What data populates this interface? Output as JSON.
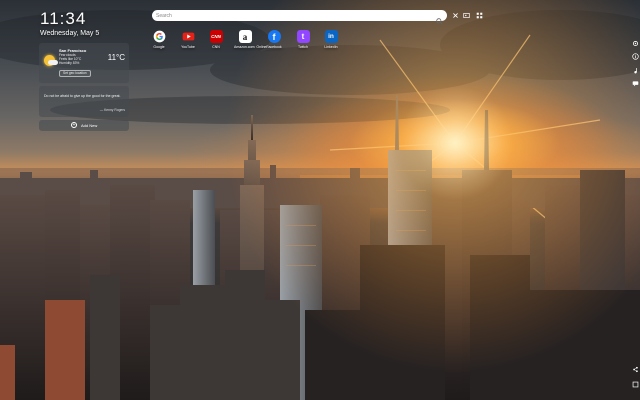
{
  "clock": {
    "time": "11:34",
    "date": "Wednesday, May 5"
  },
  "weather": {
    "city": "San Francisco",
    "condition_line1": "Few clouds",
    "condition_line2": "Feels like 10°C",
    "condition_line3": "Humidity 83%",
    "temperature": "11°C",
    "location_button": "Set geo location"
  },
  "quote": {
    "text": "Do not be afraid to give up the good for the great.",
    "author": "— Kenny Rogers"
  },
  "widgets": {
    "add_new": "Add New"
  },
  "search": {
    "placeholder": "Search"
  },
  "shortcuts": [
    {
      "name": "Google",
      "color": "#ffffff",
      "glyph": "G"
    },
    {
      "name": "YouTube",
      "color": "#e62117",
      "glyph": "▶"
    },
    {
      "name": "CNN",
      "color": "#cc0000",
      "glyph": "CNN"
    },
    {
      "name": "Amazon.com: Online...",
      "color": "#ffffff",
      "glyph": "a"
    },
    {
      "name": "Facebook",
      "color": "#1877f2",
      "glyph": "f"
    },
    {
      "name": "Twitch",
      "color": "#9146ff",
      "glyph": "t"
    },
    {
      "name": "LinkedIn",
      "color": "#0a66c2",
      "glyph": "in"
    }
  ],
  "icons": {
    "search": "search-icon",
    "apps": "apps-icon",
    "gallery": "gallery-icon",
    "close": "close-icon"
  }
}
